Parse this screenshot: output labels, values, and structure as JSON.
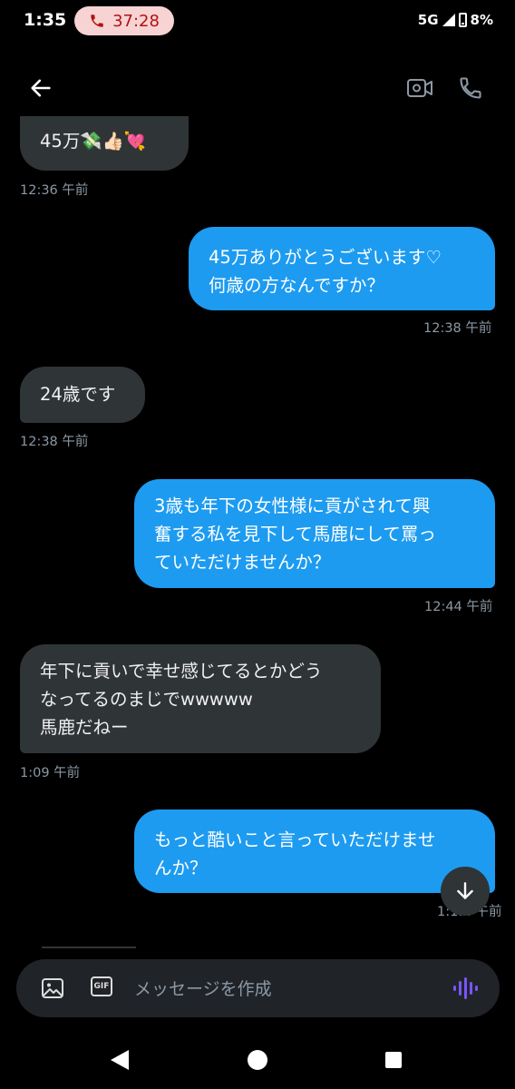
{
  "status_bar": {
    "time": "1:35",
    "call_timer": "37:28",
    "network": "5G",
    "battery": "8%"
  },
  "header": {
    "back_icon": "arrow-left-icon",
    "video_icon": "video-camera-icon",
    "phone_icon": "phone-icon"
  },
  "messages": [
    {
      "direction": "in",
      "text": "45万💸👍🏻💘",
      "time": "12:36 午前"
    },
    {
      "direction": "out",
      "lines": [
        "45万ありがとうございます♡",
        "何歳の方なんですか？"
      ],
      "time": "12:38 午前"
    },
    {
      "direction": "in",
      "text": "24歳です",
      "time": "12:38 午前"
    },
    {
      "direction": "out",
      "lines": [
        "3歳も年下の女性様に貢がされて興",
        "奮する私を見下して馬鹿にして罵っ",
        "ていただけませんか？"
      ],
      "time": "12:44 午前"
    },
    {
      "direction": "in",
      "lines": [
        "年下に貢いで幸せ感じてるとかどう",
        "なってるのまじでwwwww",
        "馬鹿だねー"
      ],
      "time": "1:09 午前"
    },
    {
      "direction": "out",
      "lines": [
        "もっと酷いこと言っていただけませ",
        "んか？"
      ],
      "time": "1:1… 午前"
    }
  ],
  "composer": {
    "placeholder": "メッセージを作成",
    "gif_label": "GIF",
    "image_icon": "image-icon",
    "voice_icon": "voice-wave-icon"
  },
  "colors": {
    "outgoing_bubble": "#1d9bf0",
    "incoming_bubble": "#2f3437",
    "call_pill": "#f7d3d3",
    "voice_accent": "#7856ff"
  }
}
